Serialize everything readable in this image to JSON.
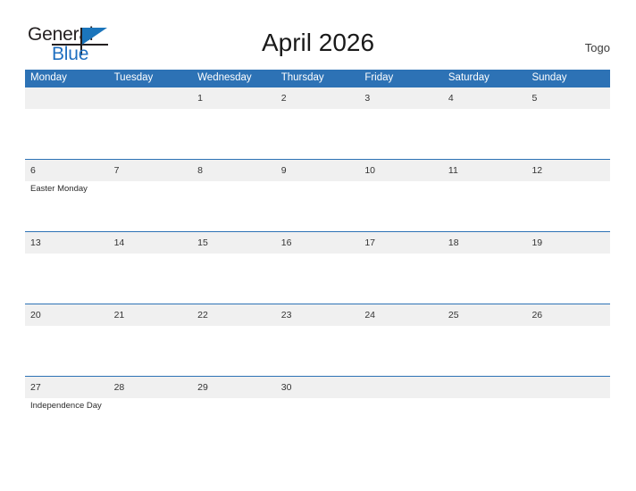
{
  "brand": {
    "word_one": "General",
    "word_two": "Blue",
    "flag_icon": "flag-triangle-icon",
    "accent_color": "#1b75bb"
  },
  "header": {
    "title": "April 2026",
    "region": "Togo"
  },
  "theme": {
    "header_blue": "#2d72b5",
    "band_gray": "#f0f0f0",
    "text_dark": "#333333"
  },
  "calendar": {
    "weekdays": [
      "Monday",
      "Tuesday",
      "Wednesday",
      "Thursday",
      "Friday",
      "Saturday",
      "Sunday"
    ],
    "weeks": [
      [
        {
          "date": "",
          "event": ""
        },
        {
          "date": "",
          "event": ""
        },
        {
          "date": "1",
          "event": ""
        },
        {
          "date": "2",
          "event": ""
        },
        {
          "date": "3",
          "event": ""
        },
        {
          "date": "4",
          "event": ""
        },
        {
          "date": "5",
          "event": ""
        }
      ],
      [
        {
          "date": "6",
          "event": "Easter Monday"
        },
        {
          "date": "7",
          "event": ""
        },
        {
          "date": "8",
          "event": ""
        },
        {
          "date": "9",
          "event": ""
        },
        {
          "date": "10",
          "event": ""
        },
        {
          "date": "11",
          "event": ""
        },
        {
          "date": "12",
          "event": ""
        }
      ],
      [
        {
          "date": "13",
          "event": ""
        },
        {
          "date": "14",
          "event": ""
        },
        {
          "date": "15",
          "event": ""
        },
        {
          "date": "16",
          "event": ""
        },
        {
          "date": "17",
          "event": ""
        },
        {
          "date": "18",
          "event": ""
        },
        {
          "date": "19",
          "event": ""
        }
      ],
      [
        {
          "date": "20",
          "event": ""
        },
        {
          "date": "21",
          "event": ""
        },
        {
          "date": "22",
          "event": ""
        },
        {
          "date": "23",
          "event": ""
        },
        {
          "date": "24",
          "event": ""
        },
        {
          "date": "25",
          "event": ""
        },
        {
          "date": "26",
          "event": ""
        }
      ],
      [
        {
          "date": "27",
          "event": "Independence Day"
        },
        {
          "date": "28",
          "event": ""
        },
        {
          "date": "29",
          "event": ""
        },
        {
          "date": "30",
          "event": ""
        },
        {
          "date": "",
          "event": ""
        },
        {
          "date": "",
          "event": ""
        },
        {
          "date": "",
          "event": ""
        }
      ]
    ]
  }
}
